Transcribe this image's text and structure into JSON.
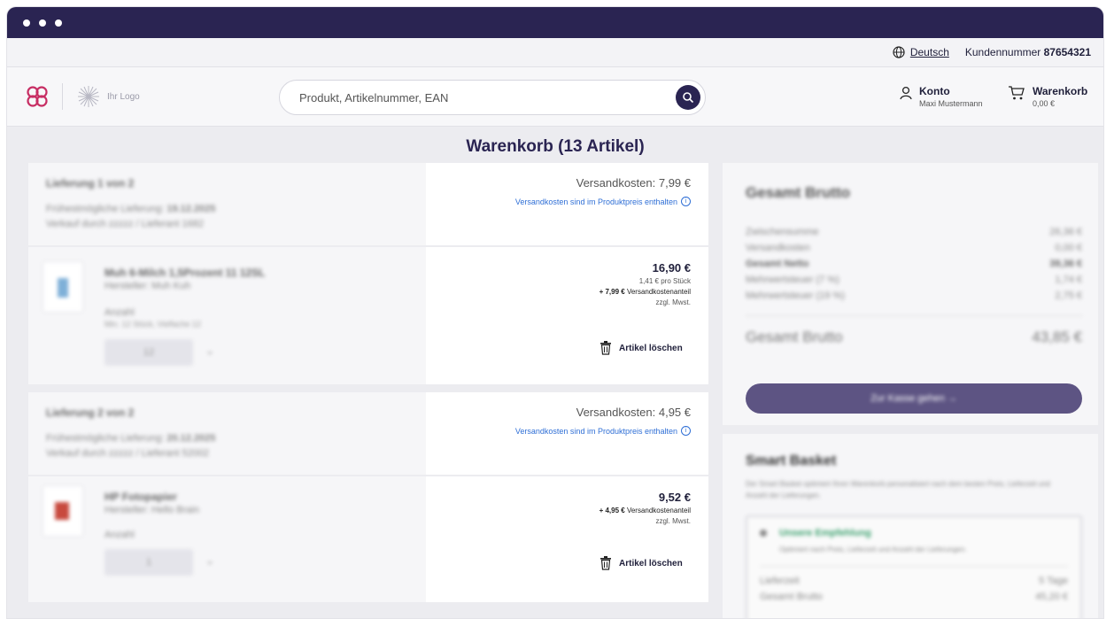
{
  "window": {
    "dots": 3
  },
  "topbar": {
    "language": "Deutsch",
    "customer_label": "Kundennummer",
    "customer_number": "87654321"
  },
  "header": {
    "logo_text": "Ihr Logo",
    "search_placeholder": "Produkt, Artikelnummer, EAN",
    "account_title": "Konto",
    "account_name": "Maxi Mustermann",
    "cart_title": "Warenkorb",
    "cart_total": "0,00 €"
  },
  "page": {
    "title": "Warenkorb (13 Artikel)"
  },
  "deliveries": [
    {
      "heading": "Lieferung 1 von 2",
      "earliest_label": "Frühestmögliche Lieferung:",
      "earliest_date": "19.12.2025",
      "seller": "Verkauf durch zzzzz / Lieferant 1682",
      "shipping_label": "Versandkosten: 7,99 €",
      "shipping_note": "Versandkosten sind im Produktpreis enthalten",
      "product_name": "Muh 6-Milch 1,5Prozent 11 12SL",
      "product_sub": "Hersteller: Muh Kuh",
      "qty_label": "Anzahl",
      "qty_hint": "Min. 12 Stück, Vielfache 12",
      "qty_value": "12",
      "price": "16,90 €",
      "unit_price": "1,41 € pro Stück",
      "shipping_share_amount": "+ 7,99 €",
      "shipping_share_label": "Versandkostenanteil",
      "vat_note": "zzgl. Mwst.",
      "delete_label": "Artikel löschen"
    },
    {
      "heading": "Lieferung 2 von 2",
      "earliest_label": "Frühestmögliche Lieferung:",
      "earliest_date": "20.12.2025",
      "seller": "Verkauf durch zzzzz / Lieferant 52002",
      "shipping_label": "Versandkosten: 4,95 €",
      "shipping_note": "Versandkosten sind im Produktpreis enthalten",
      "product_name": "HP Fotopapier",
      "product_sub": "Hersteller: Hello Brain",
      "qty_label": "Anzahl",
      "qty_value": "1",
      "price": "9,52 €",
      "shipping_share_amount": "+ 4,95 €",
      "shipping_share_label": "Versandkostenanteil",
      "vat_note": "zzgl. Mwst.",
      "delete_label": "Artikel löschen"
    }
  ],
  "summary": {
    "title": "Gesamt Brutto",
    "rows": [
      {
        "label": "Zwischensumme",
        "value": "26,36 €"
      },
      {
        "label": "Versandkosten",
        "value": "0,00 €"
      },
      {
        "label": "Gesamt Netto",
        "value": "39,36 €"
      },
      {
        "label": "Mehrwertsteuer (7 %)",
        "value": "1,74 €"
      },
      {
        "label": "Mehrwertsteuer (19 %)",
        "value": "2,75 €"
      }
    ],
    "total_label": "Gesamt Brutto",
    "total_value": "43,85 €",
    "checkout_label": "Zur Kasse gehen →"
  },
  "smart_basket": {
    "title": "Smart Basket",
    "description": "Der Smart Basket optimiert Ihren Warenkorb personalisiert nach dem besten Preis, Lieferzeit und Anzahl der Lieferungen.",
    "recommendation_title": "Unsere Empfehlung",
    "recommendation_text": "Optimiert nach Preis, Lieferzeit und Anzahl der Lieferungen.",
    "row_label": "Lieferzeit",
    "row_value": "5 Tage",
    "row2_label": "Gesamt Brutto",
    "row2_value": "45,20 €"
  }
}
